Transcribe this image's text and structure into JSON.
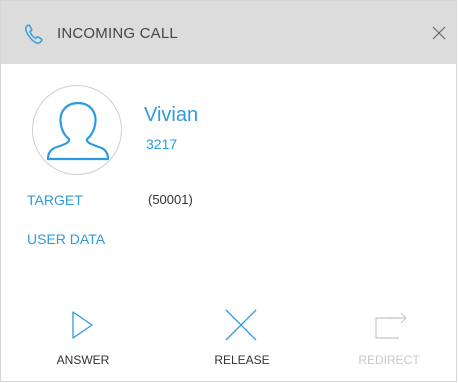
{
  "window": {
    "title": "INCOMING CALL",
    "title_icon": "phone-icon",
    "close_icon": "close-icon"
  },
  "caller": {
    "name": "Vivian",
    "number": "3217",
    "avatar_icon": "user-avatar-icon"
  },
  "details": {
    "target_label": "TARGET",
    "target_value": "(50001)",
    "user_data_label": "USER DATA"
  },
  "actions": [
    {
      "label": "ANSWER",
      "icon": "play-icon",
      "enabled": true
    },
    {
      "label": "RELEASE",
      "icon": "x-icon",
      "enabled": true
    },
    {
      "label": "REDIRECT",
      "icon": "redirect-arrow-icon",
      "enabled": false
    }
  ],
  "colors": {
    "accent": "#2e9ae0",
    "titlebar": "#dcdcdc",
    "disabled": "#c8c8c8"
  }
}
